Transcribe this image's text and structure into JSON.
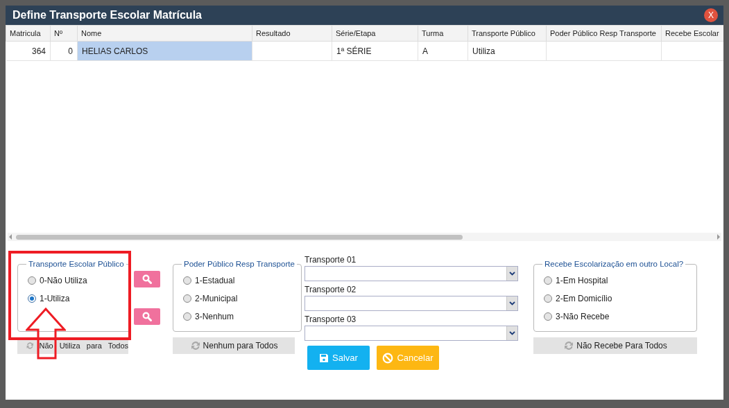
{
  "window": {
    "title": "Define Transporte Escolar Matrícula",
    "close": "X"
  },
  "table": {
    "columns": [
      {
        "label": "Matricula"
      },
      {
        "label": "Nº"
      },
      {
        "label": "Nome"
      },
      {
        "label": "Resultado"
      },
      {
        "label": "Série/Etapa"
      },
      {
        "label": "Turma"
      },
      {
        "label": "Transporte Público"
      },
      {
        "label": "Poder Público Resp Transporte"
      },
      {
        "label": "Recebe Escolar"
      }
    ],
    "rows": [
      {
        "cells": [
          {
            "text": "364",
            "selected": false
          },
          {
            "text": "0",
            "selected": false
          },
          {
            "text": "HELIAS CARLOS",
            "selected": true
          },
          {
            "selected": false
          },
          {
            "text": "1ª SÉRIE",
            "selected": false
          },
          {
            "text": "A",
            "selected": false
          },
          {
            "text": "Utiliza",
            "selected": false
          },
          {
            "selected": false
          },
          {
            "selected": false
          }
        ]
      }
    ]
  },
  "transport_group": {
    "title": "Transporte Escolar Público",
    "options": [
      {
        "label": "0-Não Utiliza",
        "checked": false
      },
      {
        "label": "1-Utiliza",
        "checked": true
      }
    ],
    "bulk_button": "Não Utiliza para Todos"
  },
  "authority_group": {
    "title": "Poder Público Resp Transporte",
    "options": [
      {
        "label": "1-Estadual",
        "checked": false
      },
      {
        "label": "2-Municipal",
        "checked": false
      },
      {
        "label": "3-Nenhum",
        "checked": false
      }
    ],
    "bulk_button": "Nenhum para Todos"
  },
  "selects": [
    {
      "label": "Transporte 01"
    },
    {
      "label": "Transporte 02"
    },
    {
      "label": "Transporte 03"
    }
  ],
  "other_location_group": {
    "title": "Recebe Escolarização em outro Local?",
    "options": [
      {
        "label": "1-Em Hospital",
        "checked": false
      },
      {
        "label": "2-Em Domicílio",
        "checked": false
      },
      {
        "label": "3-Não Recebe",
        "checked": false
      }
    ],
    "bulk_button": "Não Recebe Para Todos"
  },
  "actions": [
    {
      "label": "Salvar",
      "kind": "save"
    },
    {
      "label": "Cancelar",
      "kind": "cancel"
    }
  ]
}
